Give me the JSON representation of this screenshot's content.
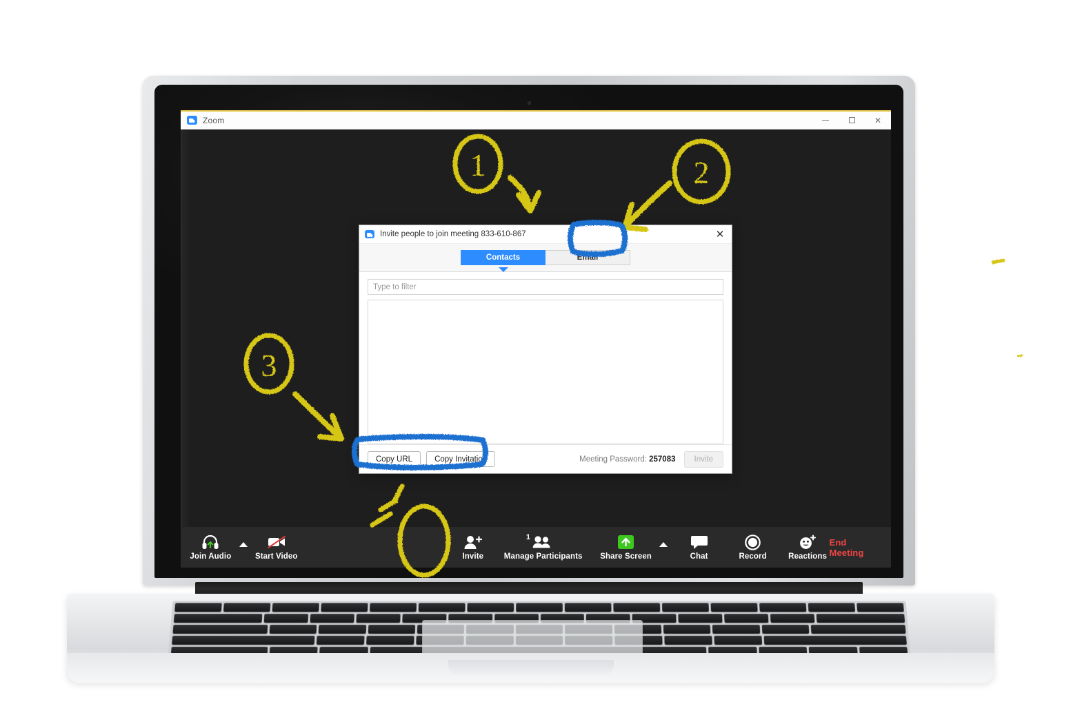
{
  "app": {
    "window_title": "Zoom",
    "logo_icon": "zoom-logo-icon",
    "minimize_label": "–",
    "maximize_label": "□",
    "close_label": "✕"
  },
  "dialog": {
    "title": "Invite people to join meeting 833-610-867",
    "close_icon": "close-icon",
    "tabs": [
      {
        "label": "Contacts",
        "active": true
      },
      {
        "label": "Email",
        "active": false
      }
    ],
    "filter": {
      "placeholder": "Type to filter",
      "value": ""
    },
    "contacts": [],
    "footer": {
      "copy_url_label": "Copy URL",
      "copy_invitation_label": "Copy Invitation",
      "password_label": "Meeting Password:",
      "password_value": "257083",
      "invite_label": "Invite"
    }
  },
  "toolbar": {
    "items": [
      {
        "label": "Join Audio",
        "icon": "headset-join-audio-icon",
        "has_caret": true
      },
      {
        "label": "Start Video",
        "icon": "video-off-icon",
        "has_caret": false
      },
      {
        "label": "Invite",
        "icon": "person-add-icon",
        "has_caret": false
      },
      {
        "label": "Manage Participants",
        "icon": "participants-icon",
        "badge": "1",
        "has_caret": false
      },
      {
        "label": "Share Screen",
        "icon": "share-screen-up-arrow-icon",
        "has_caret": true
      },
      {
        "label": "Chat",
        "icon": "chat-bubble-icon",
        "has_caret": false
      },
      {
        "label": "Record",
        "icon": "record-circle-icon",
        "has_caret": false
      },
      {
        "label": "Reactions",
        "icon": "smiley-reactions-icon",
        "has_caret": false
      }
    ],
    "end_meeting_label": "End Meeting"
  },
  "annotations": {
    "marker_color_yellow": "#d6c619",
    "marker_color_blue": "#1f6fd0",
    "steps": [
      {
        "number": "1",
        "points_to": "dialog-title-bar"
      },
      {
        "number": "2",
        "points_to": "email-tab"
      },
      {
        "number": "3",
        "points_to": "copy-url-and-copy-invitation-buttons"
      }
    ],
    "highlight_boxes": [
      "email-tab",
      "copy-buttons-group"
    ],
    "circled_toolbar_item": "Invite"
  },
  "colors": {
    "zoom_blue": "#2d8cff",
    "end_meeting_red": "#ef4444",
    "share_screen_green": "#3ec720",
    "screen_background": "#1e1e1e",
    "toolbar_background": "#2a2a2a"
  }
}
